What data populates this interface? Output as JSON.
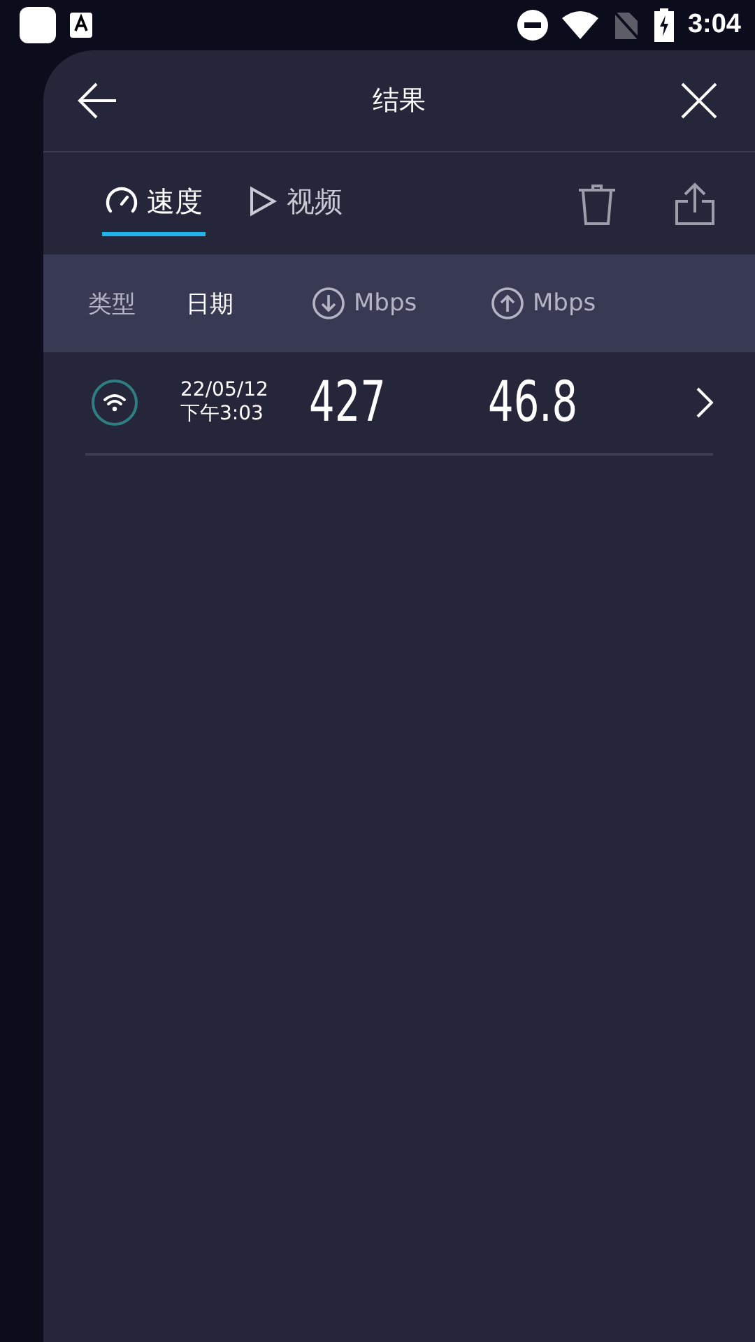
{
  "status_bar": {
    "time": "3:04"
  },
  "header": {
    "title": "结果"
  },
  "tabs": [
    {
      "label": "速度",
      "kind": "speed",
      "selected": true
    },
    {
      "label": "视频",
      "kind": "video",
      "selected": false
    }
  ],
  "columns": [
    {
      "label": "类型",
      "kind": "text",
      "selected": false
    },
    {
      "label": "日期",
      "kind": "text",
      "selected": true
    },
    {
      "label": "Mbps",
      "kind": "download",
      "selected": false
    },
    {
      "label": "Mbps",
      "kind": "upload",
      "selected": false
    }
  ],
  "rows": [
    {
      "date": "22/05/12",
      "time": "下午3:03",
      "download": "427",
      "upload": "46.8"
    }
  ]
}
